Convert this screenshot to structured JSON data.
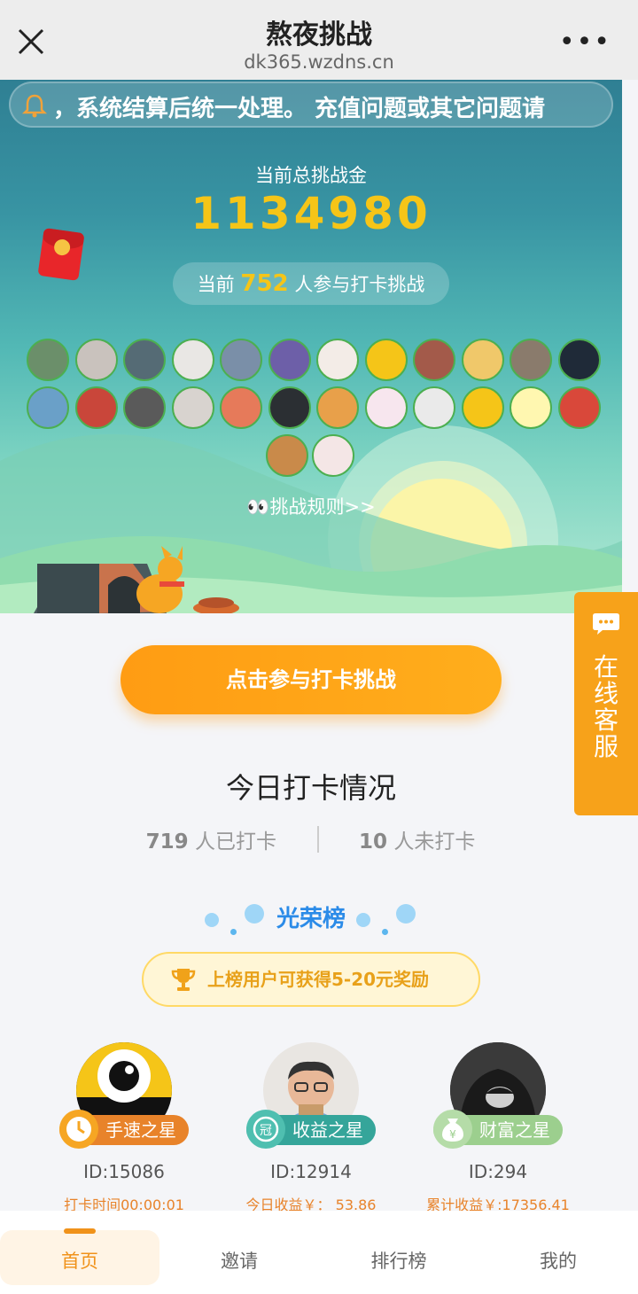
{
  "topbar": {
    "title": "熬夜挑战",
    "url": "dk365.wzdns.cn"
  },
  "notice": {
    "text": "，系统结算后统一处理。   充值问题或其它问题请"
  },
  "pool": {
    "label": "当前总挑战金",
    "amount": "1134980"
  },
  "participants": {
    "prefix": "当前",
    "count": "752",
    "suffix": "人参与打卡挑战"
  },
  "rules_link": "👀挑战规则>>",
  "customer_service": {
    "label": "在线客服"
  },
  "cta": {
    "label": "点击参与打卡挑战"
  },
  "today": {
    "title": "今日打卡情况",
    "checked_count": "719",
    "checked_label": "人已打卡",
    "unchecked_count": "10",
    "unchecked_label": "人未打卡"
  },
  "honor": {
    "title": "光荣榜",
    "reward": "上榜用户可获得5-20元奖励",
    "stars": [
      {
        "badge": "手速之星",
        "id": "ID:15086",
        "info": "打卡时间00:00:01",
        "color": "#e8832a"
      },
      {
        "badge": "收益之星",
        "id": "ID:12914",
        "info": "今日收益￥： 53.86",
        "color": "#35a59a"
      },
      {
        "badge": "财富之星",
        "id": "ID:294",
        "info": "累计收益￥:17356.41",
        "color": "#9ccf8e"
      }
    ]
  },
  "tabs": [
    {
      "label": "首页"
    },
    {
      "label": "邀请"
    },
    {
      "label": "排行榜"
    },
    {
      "label": "我的"
    }
  ]
}
